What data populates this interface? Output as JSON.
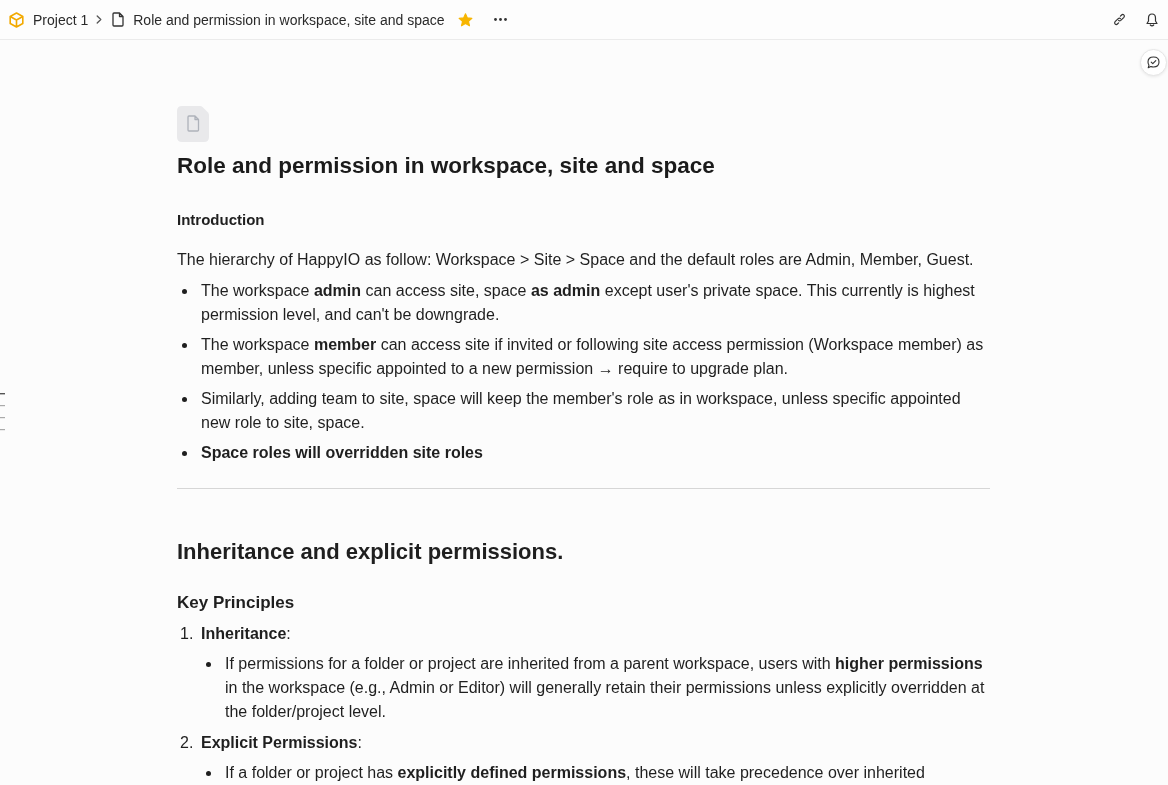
{
  "breadcrumb": {
    "project": "Project 1",
    "page": "Role and permission in workspace, site and space",
    "starred": true
  },
  "document": {
    "title": "Role and permission in workspace, site and space",
    "blocks": [
      {
        "kind": "small_heading",
        "text": "Introduction"
      },
      {
        "kind": "paragraph",
        "text": "The hierarchy of HappyIO as follow: Workspace > Site > Space and the default roles are Admin, Member, Guest."
      },
      {
        "kind": "bullet_list",
        "items": [
          {
            "text": "The workspace **admin** can access site, space **as admin** except user's private space. This currently is highest permission level, and can't be downgrade."
          },
          {
            "text": "The workspace **member** can access site if invited or following site access permission (Workspace member) as member, unless specific appointed to a new permission → require to upgrade plan."
          },
          {
            "text": "Similarly, adding team to site, space will keep the member's role as in workspace, unless specific appointed new role to site, space."
          },
          {
            "text": "**Space roles will overridden site roles**"
          }
        ]
      },
      {
        "kind": "divider"
      },
      {
        "kind": "heading",
        "text": "Inheritance and explicit permissions."
      },
      {
        "kind": "subheading",
        "text": "Key Principles"
      },
      {
        "kind": "numbered_list",
        "items": [
          {
            "marker": "1.",
            "text": "**Inheritance**:",
            "children": [
              {
                "text": "If permissions for a folder or project are inherited from a parent workspace, users with **higher permissions** in the workspace (e.g., Admin or Editor) will generally retain their permissions unless explicitly overridden at the folder/project level."
              }
            ]
          },
          {
            "marker": "2.",
            "text": "**Explicit Permissions**:",
            "children": [
              {
                "text": "If a folder or project has **explicitly defined permissions**, these will take precedence over inherited"
              }
            ]
          }
        ]
      }
    ]
  }
}
